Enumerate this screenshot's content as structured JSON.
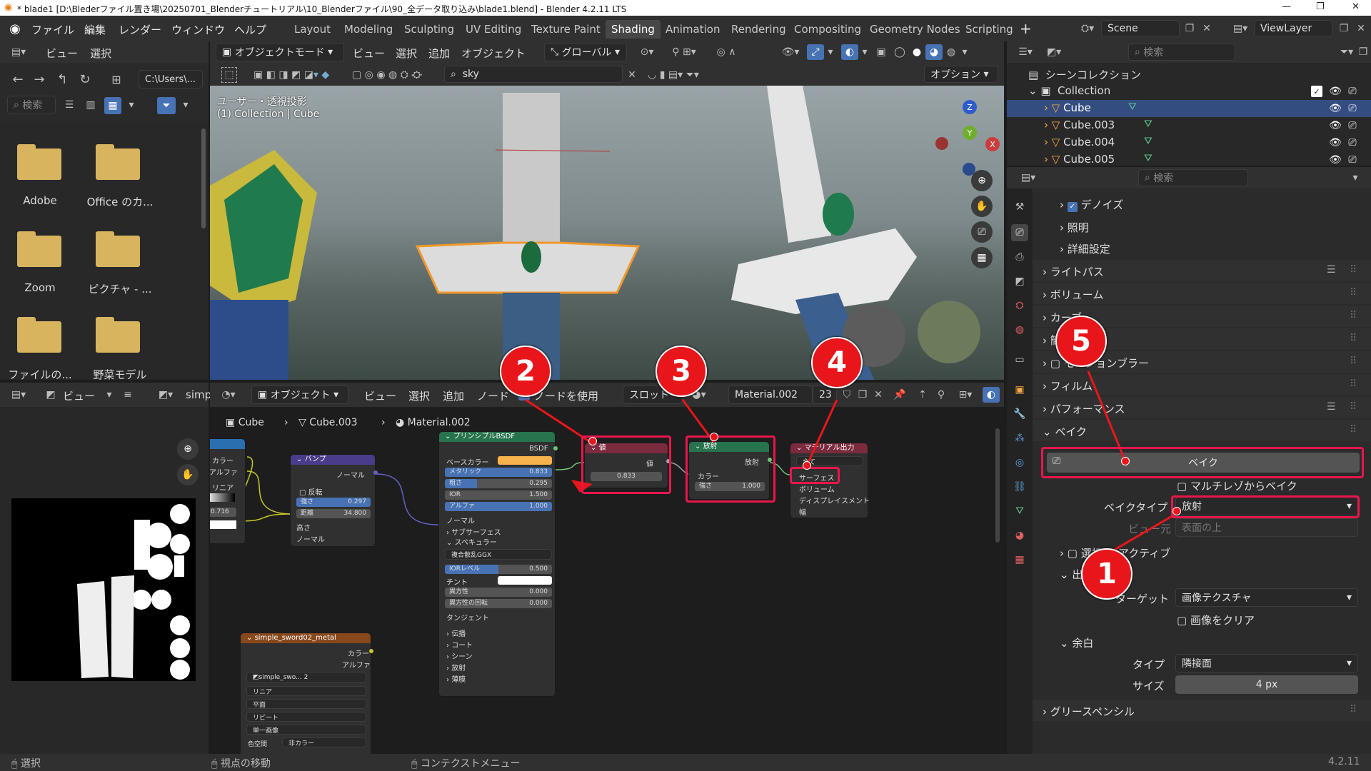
{
  "window": {
    "title": "* blade1 [D:\\Blederファイル置き場\\20250701_Blenderチュートリアル\\10_Blenderファイル\\90_全データ取り込み\\blade1.blend] - Blender 4.2.11 LTS",
    "minimize": "—",
    "maximize": "❐",
    "close": "✕"
  },
  "menubar": {
    "items": [
      "ファイル",
      "編集",
      "レンダー",
      "ウィンドウ",
      "ヘルプ"
    ],
    "workspaces": [
      "Layout",
      "Modeling",
      "Sculpting",
      "UV Editing",
      "Texture Paint",
      "Shading",
      "Animation",
      "Rendering",
      "Compositing",
      "Geometry Nodes",
      "Scripting"
    ],
    "active_workspace": "Shading",
    "add_workspace": "+",
    "scene": "Scene",
    "view_layer": "ViewLayer"
  },
  "file_browser": {
    "header_items": [
      "ビュー",
      "選択"
    ],
    "path": "C:\\Users\\...",
    "search_placeholder": "検索",
    "folders": [
      {
        "name": "Adobe",
        "icon": "folder-icon"
      },
      {
        "name": "Office のカ...",
        "icon": "folder-icon"
      },
      {
        "name": "Zoom",
        "icon": "folder-icon"
      },
      {
        "name": "ピクチャ - ...",
        "icon": "picture-folder-icon"
      },
      {
        "name": "ファイルの...",
        "icon": "file-folder-icon"
      },
      {
        "name": "野菜モデル",
        "icon": "folder-icon"
      }
    ]
  },
  "viewport": {
    "mode": "オブジェクトモード",
    "menus": [
      "ビュー",
      "選択",
      "追加",
      "オブジェクト"
    ],
    "transform": "グローバル",
    "search_value": "sky",
    "options": "オプション",
    "overlay_line1": "ユーザー・透視投影",
    "overlay_line2": "(1) Collection | Cube",
    "gizmo": {
      "z": "Z",
      "y": "Y",
      "x": "X"
    }
  },
  "image_editor": {
    "view": "ビュー",
    "image_name": "simp"
  },
  "node_editor": {
    "mode": "オブジェクト",
    "menus": [
      "ビュー",
      "選択",
      "追加",
      "ノード"
    ],
    "use_nodes": "ノードを使用",
    "slot": "スロット",
    "material": "Material.002",
    "users": "23",
    "breadcrumb": [
      "Cube",
      "Cube.003",
      "Material.002"
    ],
    "nodes": {
      "bump": {
        "title": "バンプ",
        "normal_out": "ノーマル",
        "invert": "反転",
        "strength_label": "強さ",
        "strength": "0.297",
        "distance_label": "距離",
        "distance": "34.800",
        "height": "高さ",
        "normal_in": "ノーマル"
      },
      "principled": {
        "title": "プリンシプルBSDF",
        "out": "BSDF",
        "base_color": "ベースカラー",
        "metallic_label": "メタリック",
        "metallic": "0.833",
        "roughness_label": "粗さ",
        "roughness": "0.295",
        "ior_label": "IOR",
        "ior": "1.500",
        "alpha_label": "アルファ",
        "alpha": "1.000",
        "normal": "ノーマル",
        "subsurface": "サブサーフェス",
        "specular": "スペキュラー",
        "distribution": "複合散乱GGX",
        "ior_level_label": "IORレベル",
        "ior_level": "0.500",
        "tint": "チント",
        "aniso_label": "異方性",
        "aniso": "0.000",
        "aniso_rot_label": "異方性の回転",
        "aniso_rot": "0.000",
        "tangent": "タンジェント",
        "sections": [
          "伝播",
          "コート",
          "シーン",
          "放射",
          "薄膜"
        ]
      },
      "value": {
        "title": "値",
        "out": "値",
        "value": "0.833"
      },
      "emission": {
        "title": "放射",
        "out": "放射",
        "color": "カラー",
        "strength_label": "強さ",
        "strength": "1.000"
      },
      "output": {
        "title": "マテリアル出力",
        "target": "全て",
        "surface": "サーフェス",
        "volume": "ボリューム",
        "displacement": "ディスプレイスメント",
        "thickness": "幅"
      },
      "image_left": {
        "color": "カラー",
        "alpha": "アルファ",
        "interp": "リニア",
        "value": "0.716"
      },
      "image_metal": {
        "title": "simple_sword02_metal",
        "color": "カラー",
        "alpha": "アルファ",
        "image": "simple_swo...",
        "users": "2",
        "interp": "リニア",
        "projection": "平面",
        "extension": "リピート",
        "source": "単一画像",
        "colorspace_label": "色空間",
        "colorspace": "非カラー"
      }
    }
  },
  "outliner": {
    "search_placeholder": "検索",
    "scene_collection": "シーンコレクション",
    "collection": "Collection",
    "objects": [
      "Cube",
      "Cube.003",
      "Cube.004",
      "Cube.005"
    ],
    "selected": "Cube"
  },
  "properties": {
    "search_placeholder": "検索",
    "denoise": "デノイズ",
    "lighting": "照明",
    "advanced": "詳細設定",
    "panels": [
      "ライトパス",
      "ボリューム",
      "カーブ",
      "簡略化",
      "モーションブラー",
      "フィルム",
      "パフォーマンス"
    ],
    "bake_panel": "ベイク",
    "bake_button": "ベイク",
    "multires": "マルチレゾからベイク",
    "bake_type_label": "ベイクタイプ",
    "bake_type": "放射",
    "view_from_label": "ビュー元",
    "view_from": "表面の上",
    "selected_to_active": "選択 → アクティブ",
    "output": "出力",
    "target_label": "ターゲット",
    "target": "画像テクスチャ",
    "clear_image": "画像をクリア",
    "margin": "余白",
    "margin_type_label": "タイプ",
    "margin_type": "隣接面",
    "margin_size_label": "サイズ",
    "margin_size": "4 px",
    "grease_pencil": "グリースペンシル"
  },
  "statusbar": {
    "select": "選択",
    "move_view": "視点の移動",
    "context_menu": "コンテクストメニュー",
    "version": "4.2.11"
  },
  "annotations": [
    "1",
    "2",
    "3",
    "4",
    "5"
  ],
  "colors": {
    "accent": "#4772b3",
    "selected_row": "#334d80",
    "callout": "#e8161b",
    "highlight": "#e8164c",
    "principled_header": "#26734d",
    "value_header": "#7a2b3d",
    "emission_header": "#26734d",
    "bump_header": "#4a3c8a",
    "image_header": "#87481c"
  }
}
